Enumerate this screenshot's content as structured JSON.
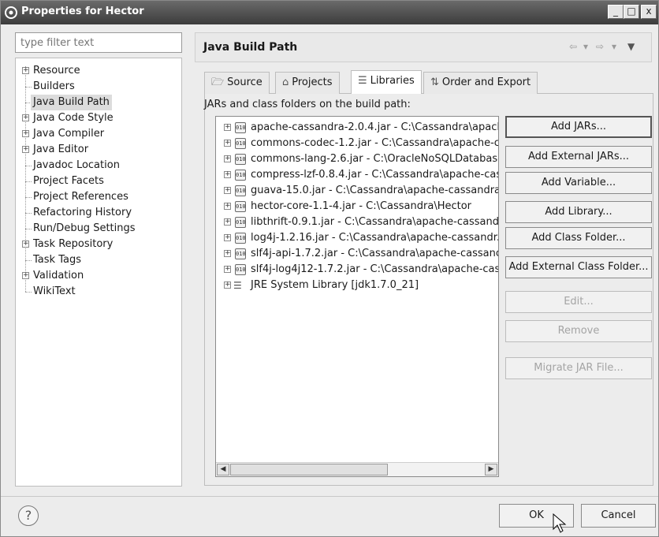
{
  "window": {
    "title": "Properties for Hector",
    "buttons": {
      "minimize": "_",
      "maximize": "□",
      "close": "x"
    }
  },
  "filter": {
    "placeholder": "type filter text"
  },
  "nav": {
    "items": [
      {
        "label": "Resource",
        "expandable": true
      },
      {
        "label": "Builders",
        "expandable": false
      },
      {
        "label": "Java Build Path",
        "expandable": false,
        "selected": true
      },
      {
        "label": "Java Code Style",
        "expandable": true
      },
      {
        "label": "Java Compiler",
        "expandable": true
      },
      {
        "label": "Java Editor",
        "expandable": true
      },
      {
        "label": "Javadoc Location",
        "expandable": false
      },
      {
        "label": "Project Facets",
        "expandable": false
      },
      {
        "label": "Project References",
        "expandable": false
      },
      {
        "label": "Refactoring History",
        "expandable": false
      },
      {
        "label": "Run/Debug Settings",
        "expandable": false
      },
      {
        "label": "Task Repository",
        "expandable": true
      },
      {
        "label": "Task Tags",
        "expandable": false
      },
      {
        "label": "Validation",
        "expandable": true
      },
      {
        "label": "WikiText",
        "expandable": false
      }
    ]
  },
  "page": {
    "title": "Java Build Path",
    "header_nav": {
      "back": "⇦",
      "down1": "▾",
      "forward": "⇨",
      "down2": "▾",
      "menu": "▼"
    }
  },
  "tabs": [
    {
      "label": "Source",
      "icon": "source-folder-icon",
      "glyph": "🗁"
    },
    {
      "label": "Projects",
      "icon": "projects-icon",
      "glyph": "⌂"
    },
    {
      "label": "Libraries",
      "icon": "libraries-icon",
      "glyph": "☰",
      "active": true
    },
    {
      "label": "Order and Export",
      "icon": "order-export-icon",
      "glyph": "⇅"
    }
  ],
  "libraries": {
    "caption": "JARs and class folders on the build path:",
    "entries": [
      {
        "text": "apache-cassandra-2.0.4.jar - C:\\Cassandra\\apacl",
        "type": "jar"
      },
      {
        "text": "commons-codec-1.2.jar - C:\\Cassandra\\apache-ca",
        "type": "jar"
      },
      {
        "text": "commons-lang-2.6.jar - C:\\OracleNoSQLDatabase",
        "type": "jar"
      },
      {
        "text": "compress-lzf-0.8.4.jar - C:\\Cassandra\\apache-cas",
        "type": "jar"
      },
      {
        "text": "guava-15.0.jar - C:\\Cassandra\\apache-cassandra",
        "type": "jar"
      },
      {
        "text": "hector-core-1.1-4.jar - C:\\Cassandra\\Hector",
        "type": "jar"
      },
      {
        "text": "libthrift-0.9.1.jar - C:\\Cassandra\\apache-cassand",
        "type": "jar"
      },
      {
        "text": "log4j-1.2.16.jar - C:\\Cassandra\\apache-cassandr.",
        "type": "jar"
      },
      {
        "text": "slf4j-api-1.7.2.jar - C:\\Cassandra\\apache-cassanc",
        "type": "jar"
      },
      {
        "text": "slf4j-log4j12-1.7.2.jar - C:\\Cassandra\\apache-cas",
        "type": "jar"
      },
      {
        "text": "JRE System Library [jdk1.7.0_21]",
        "type": "jre"
      }
    ],
    "jar_badge": "010"
  },
  "buttons": [
    {
      "label": "Add JARs...",
      "name": "add-jars-button",
      "enabled": true,
      "default": true
    },
    {
      "label": "Add External JARs...",
      "name": "add-external-jars-button",
      "enabled": true
    },
    {
      "label": "Add Variable...",
      "name": "add-variable-button",
      "enabled": true
    },
    {
      "label": "Add Library...",
      "name": "add-library-button",
      "enabled": true
    },
    {
      "label": "Add Class Folder...",
      "name": "add-class-folder-button",
      "enabled": true
    },
    {
      "label": "Add External Class Folder...",
      "name": "add-external-class-folder-button",
      "enabled": true
    },
    {
      "label": "Edit...",
      "name": "edit-button",
      "enabled": false
    },
    {
      "label": "Remove",
      "name": "remove-button",
      "enabled": false
    },
    {
      "label": "Migrate JAR File...",
      "name": "migrate-jar-button",
      "enabled": false
    }
  ],
  "dialog": {
    "help": "?",
    "ok": "OK",
    "cancel": "Cancel"
  },
  "scroll": {
    "left": "◀",
    "right": "▶"
  }
}
